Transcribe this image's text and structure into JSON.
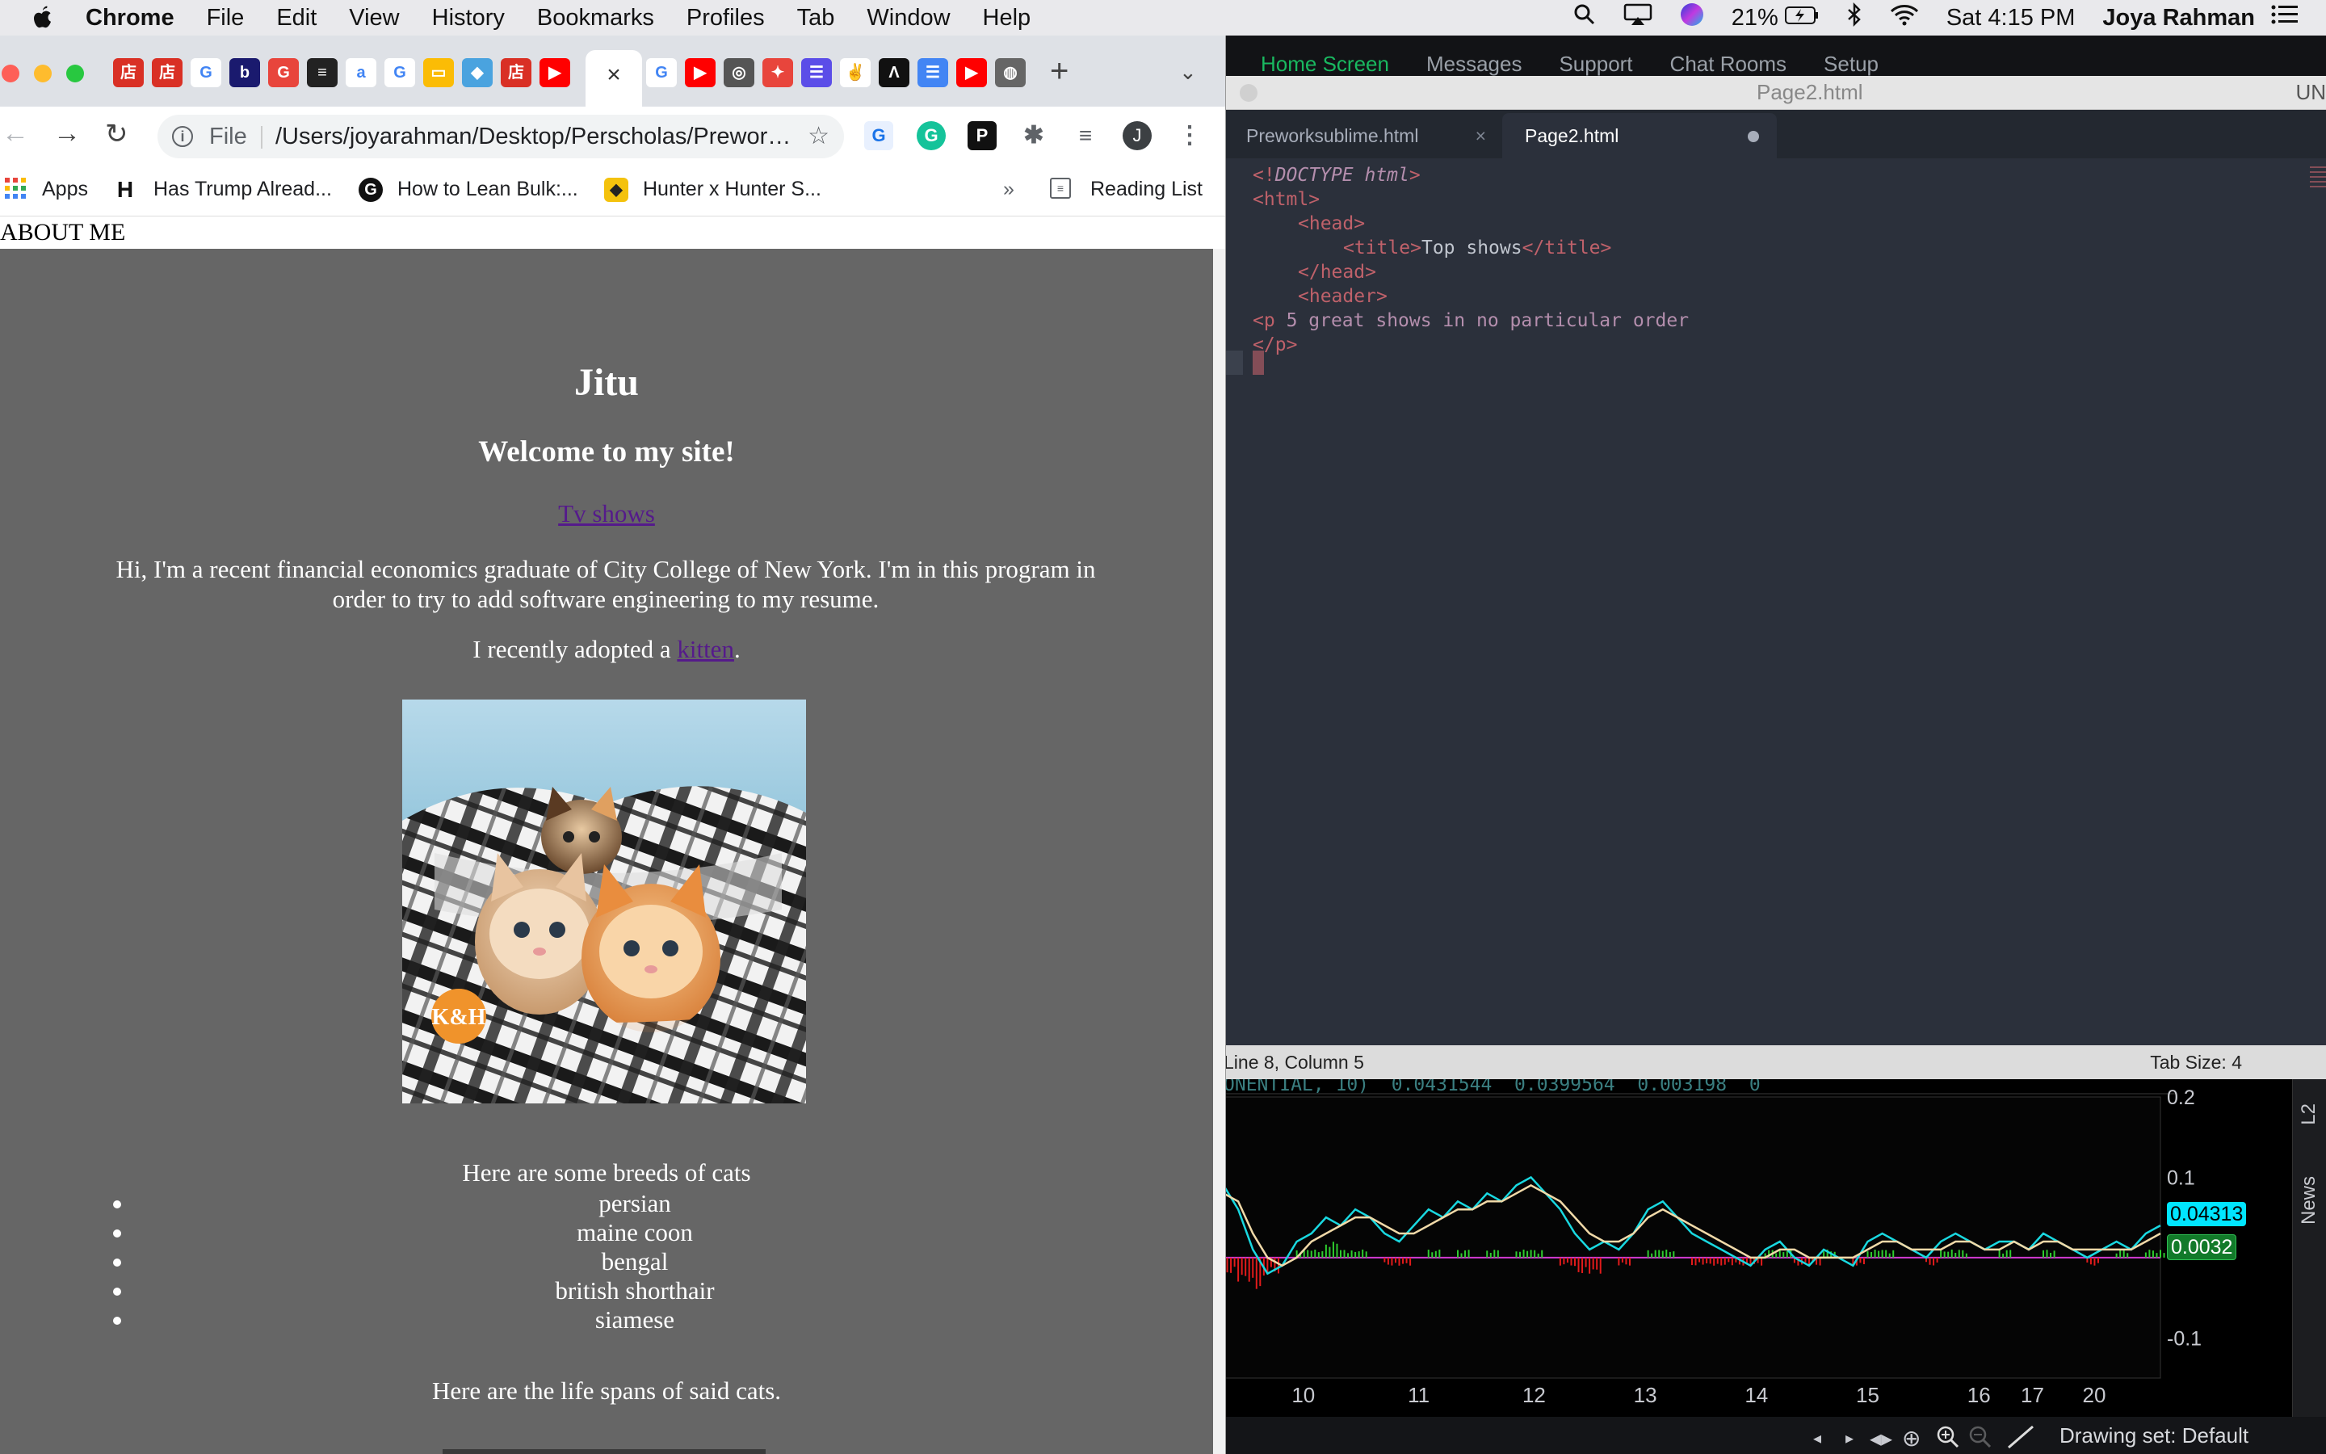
{
  "menubar": {
    "app": "Chrome",
    "items": [
      "File",
      "Edit",
      "View",
      "History",
      "Bookmarks",
      "Profiles",
      "Tab",
      "Window",
      "Help"
    ],
    "battery": "21%",
    "clock": "Sat 4:15 PM",
    "user": "Joya Rahman"
  },
  "trading_top": {
    "items": [
      "Home Screen",
      "Messages",
      "Support",
      "Chat Rooms",
      "Setup"
    ]
  },
  "sublime": {
    "window_title": "Page2.html",
    "title_right": "UN",
    "tabs": [
      {
        "label": "Preworksublime.html",
        "close": "×"
      },
      {
        "label": "Page2.html"
      }
    ],
    "code": {
      "l1": {
        "a": "<!",
        "b": "DOCTYPE html",
        "c": ">"
      },
      "l2": {
        "a": "<",
        "b": "html",
        "c": ">"
      },
      "l3": {
        "a": "<",
        "b": "head",
        "c": ">"
      },
      "l4": {
        "a": "<",
        "b": "title",
        "c": ">",
        "d": "Top shows",
        "e": "</",
        "f": "title",
        "g": ">"
      },
      "l5": {
        "a": "</",
        "b": "head",
        "c": ">"
      },
      "l6": {
        "a": "<",
        "b": "header",
        "c": ">"
      },
      "l7": {
        "a": "<",
        "b": "p",
        "c": " 5 great shows in no particular order"
      },
      "l8": {
        "a": "</",
        "b": "p",
        "c": ">"
      }
    },
    "status_left": "Line 8, Column 5",
    "status_right": "Tab Size: 4"
  },
  "chart_panel": {
    "header_text": "ONENTIAL, 10)  0.0431544  0.0399564  0.003198  0",
    "side_tabs": [
      "L2",
      "News"
    ],
    "drawing_set": "Drawing set: Default",
    "price_labels": {
      "cyan": "0.04313",
      "green": "0.0032"
    }
  },
  "chart_data": {
    "type": "line",
    "x_ticks": [
      "10",
      "11",
      "12",
      "13",
      "14",
      "15",
      "16",
      "17",
      "20"
    ],
    "y_ticks": [
      "0.2",
      "0.1",
      "-0.1"
    ],
    "ylim": [
      -0.15,
      0.2
    ],
    "series": [
      {
        "color": "#19d8e0",
        "values": [
          0.09,
          0.06,
          0.01,
          -0.02,
          -0.01,
          0.02,
          0.03,
          0.05,
          0.04,
          0.06,
          0.05,
          0.03,
          0.02,
          0.04,
          0.06,
          0.05,
          0.07,
          0.06,
          0.08,
          0.07,
          0.09,
          0.1,
          0.08,
          0.06,
          0.03,
          0.01,
          0.02,
          0.01,
          0.03,
          0.06,
          0.07,
          0.05,
          0.03,
          0.02,
          0.01,
          0.0,
          -0.01,
          0.01,
          0.02,
          0.0,
          -0.01,
          0.01,
          0.0,
          -0.01,
          0.02,
          0.03,
          0.02,
          0.01,
          0.0,
          0.02,
          0.03,
          0.02,
          0.01,
          0.02,
          0.02,
          0.01,
          0.03,
          0.02,
          0.01,
          0.0,
          0.01,
          0.02,
          0.01,
          0.03,
          0.04
        ]
      },
      {
        "color": "#f0d9a8",
        "values": [
          0.08,
          0.07,
          0.03,
          0.0,
          -0.01,
          0.0,
          0.02,
          0.03,
          0.04,
          0.05,
          0.05,
          0.04,
          0.03,
          0.03,
          0.04,
          0.05,
          0.06,
          0.06,
          0.07,
          0.07,
          0.08,
          0.09,
          0.08,
          0.07,
          0.05,
          0.03,
          0.02,
          0.02,
          0.03,
          0.05,
          0.06,
          0.05,
          0.04,
          0.03,
          0.02,
          0.01,
          0.0,
          0.0,
          0.01,
          0.01,
          0.0,
          0.0,
          0.0,
          0.0,
          0.01,
          0.02,
          0.02,
          0.01,
          0.01,
          0.01,
          0.02,
          0.02,
          0.01,
          0.01,
          0.02,
          0.01,
          0.02,
          0.02,
          0.01,
          0.01,
          0.01,
          0.01,
          0.01,
          0.02,
          0.03
        ]
      }
    ],
    "histogram": [
      -0.02,
      -0.03,
      -0.04,
      -0.02,
      0.0,
      0.01,
      0.01,
      0.02,
      0.01,
      0.01,
      0.0,
      -0.01,
      -0.01,
      0.0,
      0.01,
      0.0,
      0.01,
      0.0,
      0.01,
      0.0,
      0.01,
      0.01,
      0.0,
      -0.01,
      -0.02,
      -0.02,
      0.0,
      -0.01,
      0.0,
      0.01,
      0.01,
      0.0,
      -0.01,
      -0.01,
      -0.01,
      -0.01,
      -0.01,
      0.01,
      0.01,
      -0.01,
      -0.01,
      0.01,
      0.0,
      -0.01,
      0.01,
      0.01,
      0.0,
      0.0,
      -0.01,
      0.01,
      0.01,
      0.0,
      0.0,
      0.01,
      0.0,
      0.0,
      0.01,
      0.0,
      0.0,
      -0.01,
      0.0,
      0.01,
      0.0,
      0.01,
      0.01
    ]
  },
  "chrome": {
    "active_tab_close": "×",
    "new_tab": "+",
    "url_scheme": "File",
    "url": "/Users/joyarahman/Desktop/Perscholas/Prework/Preworksublime.html",
    "profile_initial": "J",
    "bookmarks": [
      "Apps",
      "Has Trump Alread...",
      "How to Lean Bulk:...",
      "Hunter x Hunter S..."
    ],
    "bookmarks_more": "»",
    "reading_list": "Reading List"
  },
  "page": {
    "about": "ABOUT ME",
    "site_name": "Jitu",
    "welcome": "Welcome to my site!",
    "tv_link": "Tv shows",
    "bio": "Hi, I'm a recent financial economics graduate of City College of New York. I'm in this program in order to try to add software engineering to my resume.",
    "adopt_prefix": "I recently adopted a ",
    "adopt_link": "kitten",
    "adopt_suffix": ".",
    "logo_text": "K&H",
    "breeds_intro": "Here are some breeds of cats",
    "breeds": [
      "persian",
      "maine coon",
      "bengal",
      "british shorthair",
      "siamese"
    ],
    "lifespan": "Here are the life spans of said cats."
  }
}
